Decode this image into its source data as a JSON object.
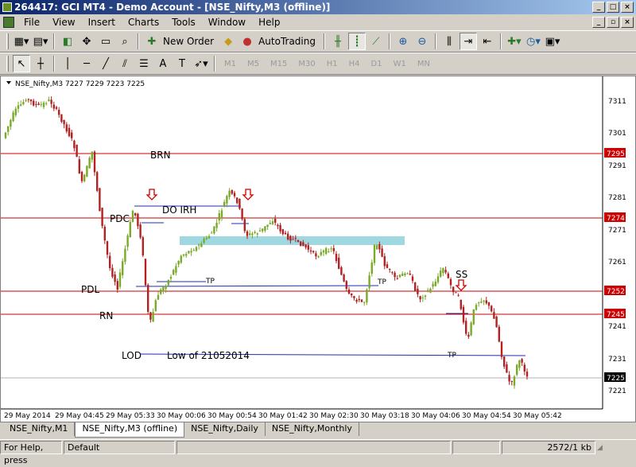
{
  "window": {
    "title": "264417: GCI MT4 - Demo Account - [NSE_Nifty,M3 (offline)]"
  },
  "menu": [
    "File",
    "View",
    "Insert",
    "Charts",
    "Tools",
    "Window",
    "Help"
  ],
  "toolbar": {
    "new_order": "New Order",
    "autotrading": "AutoTrading",
    "timeframes": [
      "M1",
      "M5",
      "M15",
      "M30",
      "H1",
      "H4",
      "D1",
      "W1",
      "MN"
    ]
  },
  "chart": {
    "header": "NSE_Nifty,M3  7227 7229 7223 7225",
    "price_labels": [
      "7311",
      "7301",
      "7291",
      "7281",
      "7271",
      "7261",
      "7241",
      "7231",
      "7221"
    ],
    "level_badges": [
      "7295",
      "7274",
      "7252",
      "7245"
    ],
    "current_price": "7225",
    "time_labels": [
      "29 May 2014",
      "29 May 04:45",
      "29 May 05:33",
      "30 May 00:06",
      "30 May 00:54",
      "30 May 01:42",
      "30 May 02:30",
      "30 May 03:18",
      "30 May 04:06",
      "30 May 04:54",
      "30 May 05:42"
    ],
    "annotations": {
      "brn": "BRN",
      "pdc": "PDC",
      "do_irh": "DO IRH",
      "pdl": "PDL",
      "rn": "RN",
      "lod": "LOD",
      "low_of": "Low of 21052014",
      "tp": "TP",
      "ss": "SS"
    },
    "colors": {
      "level_line": "#cc0000",
      "tp_line": "#1f2fae",
      "zone": "#9fd8e0",
      "bull": "#7aaa2a",
      "bear": "#b22222"
    }
  },
  "tabs": [
    "NSE_Nifty,M1",
    "NSE_Nifty,M3 (offline)",
    "NSE_Nifty,Daily",
    "NSE_Nifty,Monthly"
  ],
  "status": {
    "help": "For Help, press",
    "profile": "Default",
    "traffic": "2572/1 kb"
  }
}
